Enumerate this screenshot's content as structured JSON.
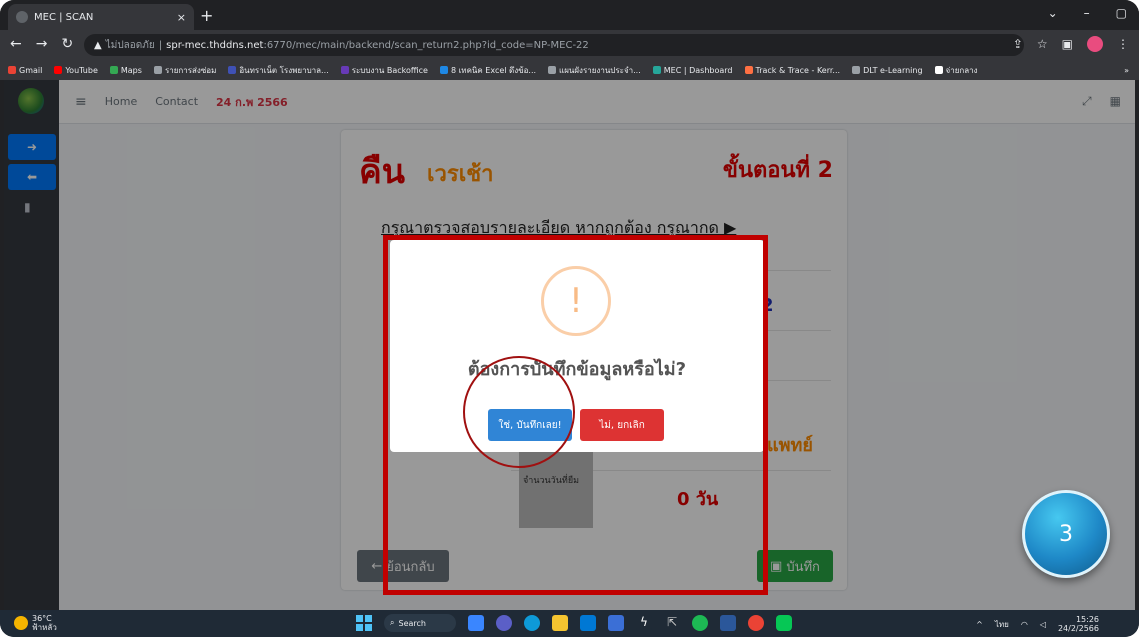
{
  "browser": {
    "tab_title": "MEC | SCAN",
    "tab_close": "×",
    "new_tab": "+",
    "security_label": "ไม่ปลอดภัย",
    "url_host": "spr-mec.thddns.net",
    "url_rest": ":6770/mec/main/backend/scan_return2.php?id_code=NP-MEC-22",
    "bookmarks": [
      {
        "label": "Gmail",
        "color": "#ea4335"
      },
      {
        "label": "YouTube",
        "color": "#ff0000"
      },
      {
        "label": "Maps",
        "color": "#34a853"
      },
      {
        "label": "รายการส่งซ่อม",
        "color": "#9aa0a6"
      },
      {
        "label": "อินทราเน็ต โรงพยาบาล...",
        "color": "#3f51b5"
      },
      {
        "label": "ระบบงาน Backoffice",
        "color": "#673ab7"
      },
      {
        "label": "8 เทคนิค Excel ดึงข้อ...",
        "color": "#1e88e5"
      },
      {
        "label": "แผนผังรายงานประจำ...",
        "color": "#9aa0a6"
      },
      {
        "label": "MEC | Dashboard",
        "color": "#26a69a"
      },
      {
        "label": "Track & Trace - Kerr...",
        "color": "#ff7043"
      },
      {
        "label": "DLT e-Learning",
        "color": "#9aa0a6"
      },
      {
        "label": "จ่ายกลาง",
        "color": "#ffffff"
      }
    ],
    "bookmarks_more": "»"
  },
  "navbar": {
    "home": "Home",
    "contact": "Contact",
    "date": "24 ก.พ 2566"
  },
  "card": {
    "title": "คืน",
    "shift": "เวรเช้า",
    "step": "ขั้นตอนที่ 2",
    "instruction": "กรุณาตรวจสอบรายละเอียด หากถูกต้อง กรุณากด ▶",
    "row2_value": "2",
    "row_label_top": "แพทย์",
    "doctor_value": "แพทย์",
    "days_label": "จำนวนวันที่ยืม",
    "days_value": "0 วัน",
    "back_label": "ย้อนกลับ",
    "save_label": "บันทึก"
  },
  "dialog": {
    "icon": "!",
    "title": "ต้องการบันทึกข้อมูลหรือไม่?",
    "confirm_label": "ใช่, บันทึกเลย!",
    "cancel_label": "ไม่, ยกเลิก"
  },
  "annotation": {
    "badge_number": "3"
  },
  "taskbar": {
    "temperature": "36°C",
    "weather_text": "ฟ้าหลัว",
    "search_label": "Search",
    "lang": "ไทย",
    "time": "15:26",
    "date": "24/2/2566"
  }
}
